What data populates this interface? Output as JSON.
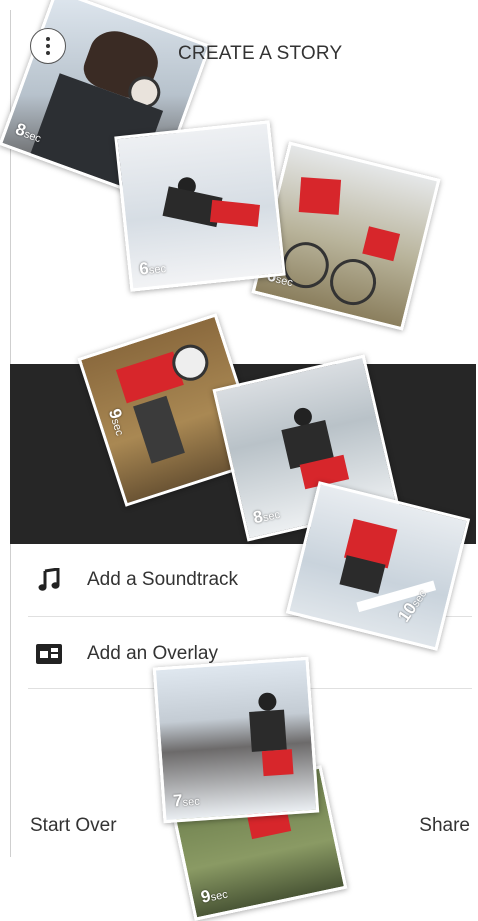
{
  "header": {
    "title": "CREATE A STORY",
    "menu_icon": "more-vertical-icon"
  },
  "clips": [
    {
      "duration": "8",
      "unit": "sec"
    },
    {
      "duration": "6",
      "unit": "sec"
    },
    {
      "duration": "6",
      "unit": "sec"
    },
    {
      "duration": "9",
      "unit": "sec"
    },
    {
      "duration": "8",
      "unit": "sec"
    },
    {
      "duration": "10",
      "unit": "sec"
    },
    {
      "duration": "7",
      "unit": "sec"
    },
    {
      "duration": "9",
      "unit": "sec"
    }
  ],
  "options": [
    {
      "label": "Add a Soundtrack",
      "icon": "music-note-icon"
    },
    {
      "label": "Add an Overlay",
      "icon": "overlay-icon"
    }
  ],
  "footer": {
    "start_over": "Start Over",
    "share": "Share"
  },
  "colors": {
    "band": "#262626",
    "accent_red": "#d7262b"
  }
}
